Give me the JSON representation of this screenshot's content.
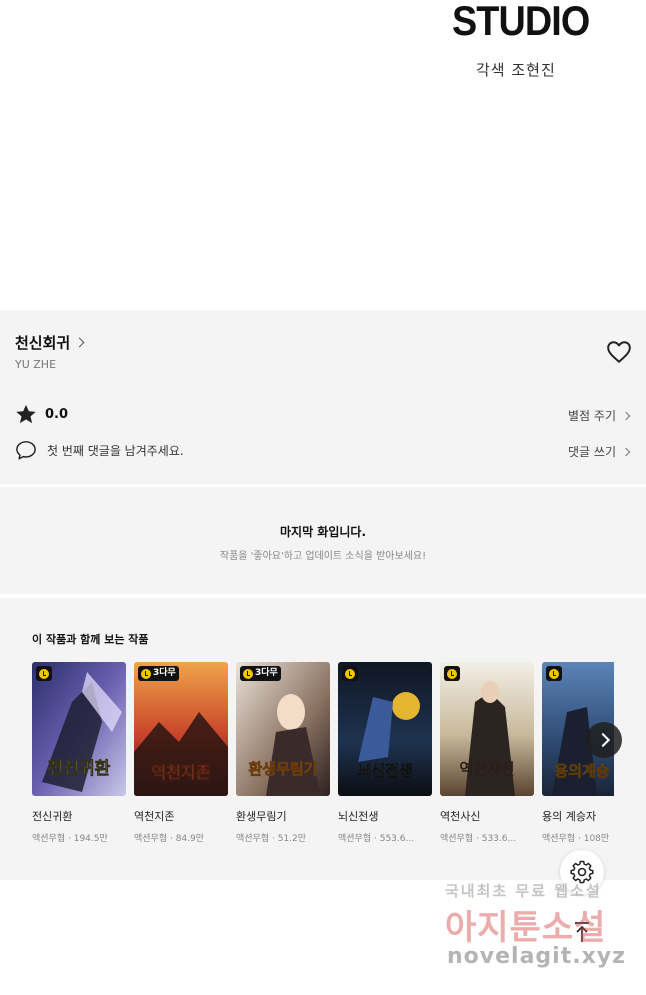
{
  "credits": {
    "studio_logo": "STUDIO",
    "line": "각색 조현진"
  },
  "work": {
    "title": "천신회귀",
    "author": "YU ZHE",
    "rating": "0.0",
    "rate_link": "별점 주기",
    "comment_prompt": "첫 번째 댓글을 남겨주세요.",
    "comment_link": "댓글 쓰기"
  },
  "notice": {
    "title": "마지막 화입니다.",
    "subtitle": "작품을 '좋아요'하고 업데이트 소식을 받아보세요!"
  },
  "recommendations": {
    "heading": "이 작품과 함께 보는 작품",
    "items": [
      {
        "title": "전신귀환",
        "genre": "액션무협",
        "views": "194.5만",
        "badge": ""
      },
      {
        "title": "역천지존",
        "genre": "액션무협",
        "views": "84.9만",
        "badge": "3다무"
      },
      {
        "title": "환생무림기",
        "genre": "액션무협",
        "views": "51.2만",
        "badge": "3다무"
      },
      {
        "title": "뇌신전생",
        "genre": "액션무협",
        "views": "553.6...",
        "badge": ""
      },
      {
        "title": "역천사신",
        "genre": "액션무협",
        "views": "533.6...",
        "badge": ""
      },
      {
        "title": "용의 계승자",
        "genre": "액션무협",
        "views": "108만",
        "badge": ""
      }
    ],
    "cover_text": [
      "전신귀환",
      "역천지존",
      "환생무림기",
      "뇌신전생",
      "역천사신",
      "용의계승"
    ]
  },
  "watermark": {
    "line1": "국내최초 무료 웹소설",
    "line2": "아지툰소설",
    "line3": "novelagit.xyz"
  },
  "icons": {
    "heart": "heart-icon",
    "star": "star-icon",
    "comment": "comment-icon",
    "settings": "gear-icon",
    "top": "arrow-up-icon",
    "next": "chevron-right-icon",
    "badge": "clock-icon"
  },
  "colors": {
    "panel_bg": "#f4f4f4",
    "badge_yellow": "#f6c400"
  }
}
